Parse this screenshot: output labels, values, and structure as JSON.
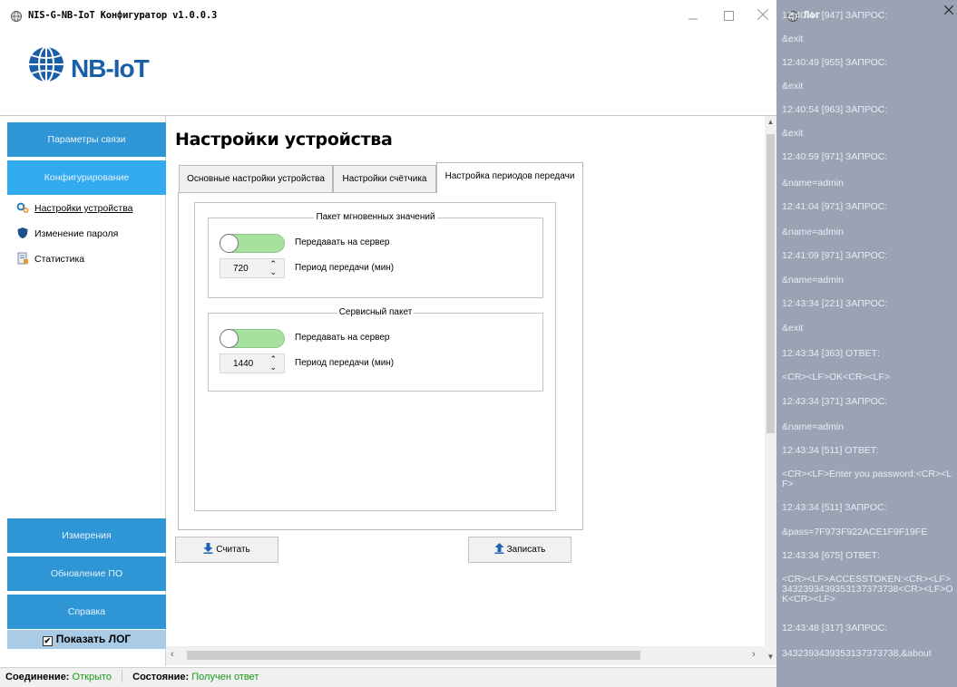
{
  "window": {
    "title": "NIS-G-NB-IoT Конфигуратор v1.0.0.3",
    "minimize_icon": "minimize-icon",
    "maximize_icon": "maximize-icon",
    "close_icon": "close-icon"
  },
  "logo": {
    "text": "NB-IoT",
    "icon": "globe-icon",
    "color": "#1a5ea8"
  },
  "sidebar": {
    "accent": "#2f96d6",
    "accent_active": "#32aaf0",
    "nav_top": [
      {
        "label": "Параметры связи"
      },
      {
        "label": "Конфигурирование",
        "active": true
      }
    ],
    "sub_items": [
      {
        "label": "Настройки устройства",
        "icon": "gears-icon",
        "selected": true
      },
      {
        "label": "Изменение пароля",
        "icon": "shield-icon"
      },
      {
        "label": "Статистика",
        "icon": "document-chart-icon"
      }
    ],
    "nav_bottom": [
      {
        "label": "Измерения"
      },
      {
        "label": "Обновление ПО"
      },
      {
        "label": "Справка"
      }
    ],
    "show_log": {
      "label": "Показать ЛОГ",
      "checked": true
    }
  },
  "main": {
    "title": "Настройки устройства",
    "tabs": [
      {
        "label": "Основные настройки устройства"
      },
      {
        "label": "Настройки счётчика"
      },
      {
        "label": "Настройка периодов передачи",
        "active": true
      }
    ],
    "groups": [
      {
        "title": "Пакет мгновенных значений",
        "toggle_label": "Передавать на сервер",
        "toggle_on": true,
        "period_value": "720",
        "period_label": "Период передачи (мин)"
      },
      {
        "title": "Сервисный пакет",
        "toggle_label": "Передавать на сервер",
        "toggle_on": true,
        "period_value": "1440",
        "period_label": "Период передачи (мин)"
      }
    ],
    "read_button": "Считать",
    "write_button": "Записать"
  },
  "status": {
    "connection_label": "Соединение:",
    "connection_value": "Открыто",
    "state_label": "Состояние:",
    "state_value": "Получен ответ",
    "value_color": "#1b9a1b"
  },
  "log": {
    "title": "Лог",
    "background": "#9aa3b4",
    "lines": [
      "12:40:44 [947] ЗАПРОС:",
      "&exit",
      "12:40:49 [955] ЗАПРОС:",
      "&exit",
      "12:40:54 [963] ЗАПРОС:",
      "&exit",
      "12:40:59 [971] ЗАПРОС:",
      "&name=admin",
      "12:41:04 [971] ЗАПРОС:",
      "&name=admin",
      "12:41:09 [971] ЗАПРОС:",
      "&name=admin",
      "12:43:34 [221] ЗАПРОС:",
      "&exit",
      "12:43:34 [363] ОТВЕТ:",
      "<CR><LF>OK<CR><LF>",
      "12:43:34 [371] ЗАПРОС:",
      "&name=admin",
      "12:43:34 [511] ОТВЕТ:",
      "<CR><LF>Enter you password:<CR><LF>",
      "12:43:34 [511] ЗАПРОС:",
      "&pass=7F973F922ACE1F9F19FE",
      "12:43:34 [675] ОТВЕТ:",
      "<CR><LF>ACCESSTOKEN:<CR><LF>3432393439353137373738<CR><LF>OK<CR><LF>",
      "12:43:48 [317] ЗАПРОС:",
      "3432393439353137373738,&about"
    ]
  }
}
